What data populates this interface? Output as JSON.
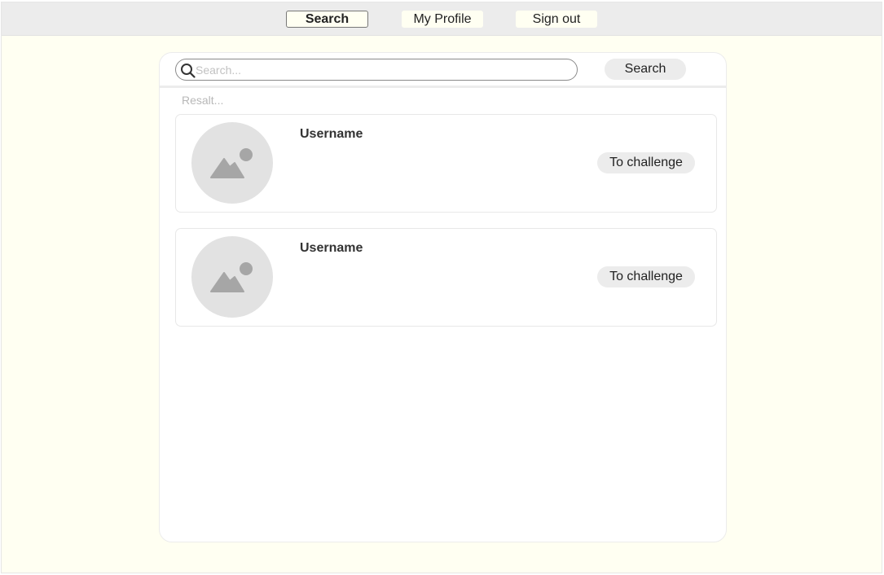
{
  "nav": {
    "items": [
      {
        "label": "Search",
        "active": true
      },
      {
        "label": "My Profile",
        "active": false
      },
      {
        "label": "Sign out",
        "active": false
      }
    ]
  },
  "search": {
    "placeholder": "Search...",
    "value": "",
    "button_label": "Search",
    "icon": "search-icon"
  },
  "results": {
    "label": "Resalt...",
    "items": [
      {
        "username": "Username",
        "action_label": "To challenge",
        "avatar_icon": "image-placeholder-icon"
      },
      {
        "username": "Username",
        "action_label": "To challenge",
        "avatar_icon": "image-placeholder-icon"
      }
    ]
  },
  "colors": {
    "page_background": "#fffff2",
    "topbar_background": "#ececec",
    "panel_background": "#ffffff",
    "button_background": "#ececec",
    "avatar_background": "#e2e2e2",
    "avatar_glyph": "#a6a6a6"
  }
}
